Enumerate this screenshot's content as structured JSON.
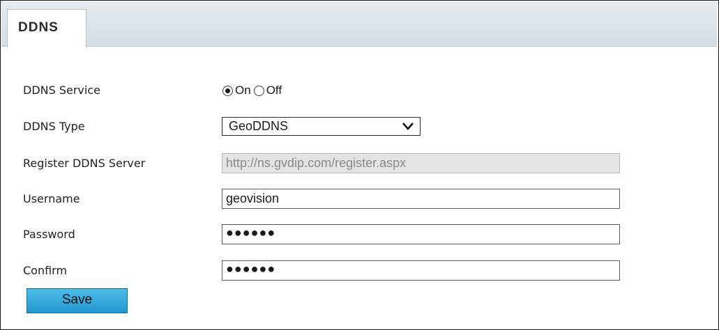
{
  "tab": {
    "label": "DDNS"
  },
  "form": {
    "service": {
      "label": "DDNS Service",
      "options": [
        {
          "label": "On",
          "selected": true
        },
        {
          "label": "Off",
          "selected": false
        }
      ]
    },
    "type": {
      "label": "DDNS Type",
      "value": "GeoDDNS"
    },
    "server": {
      "label": "Register DDNS Server",
      "value": "http://ns.gvdip.com/register.aspx",
      "disabled": true
    },
    "username": {
      "label": "Username",
      "value": "geovision"
    },
    "password": {
      "label": "Password",
      "masked_value": "●●●●●●"
    },
    "confirm": {
      "label": "Confirm",
      "masked_value": "●●●●●●"
    }
  },
  "save_label": "Save",
  "colors": {
    "tab_bar": "#d9e2e8",
    "button": "#2fa6da",
    "disabled_field": "#e4e4e4"
  },
  "icons": {
    "dropdown": "chevron-down-icon",
    "radio_on": "radio-checked-icon",
    "radio_off": "radio-unchecked-icon"
  }
}
